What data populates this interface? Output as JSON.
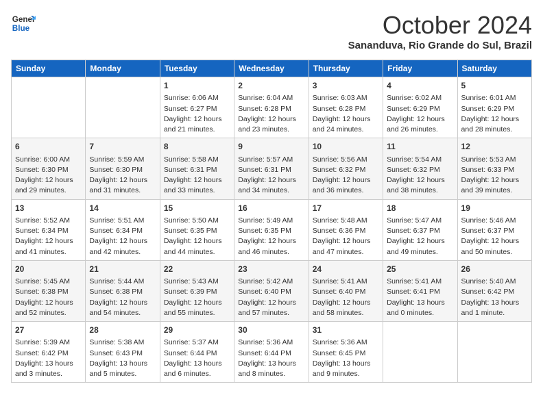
{
  "header": {
    "logo_line1": "General",
    "logo_line2": "Blue",
    "month": "October 2024",
    "location": "Sananduva, Rio Grande do Sul, Brazil"
  },
  "days_of_week": [
    "Sunday",
    "Monday",
    "Tuesday",
    "Wednesday",
    "Thursday",
    "Friday",
    "Saturday"
  ],
  "weeks": [
    [
      {
        "day": "",
        "info": ""
      },
      {
        "day": "",
        "info": ""
      },
      {
        "day": "1",
        "info": "Sunrise: 6:06 AM\nSunset: 6:27 PM\nDaylight: 12 hours and 21 minutes."
      },
      {
        "day": "2",
        "info": "Sunrise: 6:04 AM\nSunset: 6:28 PM\nDaylight: 12 hours and 23 minutes."
      },
      {
        "day": "3",
        "info": "Sunrise: 6:03 AM\nSunset: 6:28 PM\nDaylight: 12 hours and 24 minutes."
      },
      {
        "day": "4",
        "info": "Sunrise: 6:02 AM\nSunset: 6:29 PM\nDaylight: 12 hours and 26 minutes."
      },
      {
        "day": "5",
        "info": "Sunrise: 6:01 AM\nSunset: 6:29 PM\nDaylight: 12 hours and 28 minutes."
      }
    ],
    [
      {
        "day": "6",
        "info": "Sunrise: 6:00 AM\nSunset: 6:30 PM\nDaylight: 12 hours and 29 minutes."
      },
      {
        "day": "7",
        "info": "Sunrise: 5:59 AM\nSunset: 6:30 PM\nDaylight: 12 hours and 31 minutes."
      },
      {
        "day": "8",
        "info": "Sunrise: 5:58 AM\nSunset: 6:31 PM\nDaylight: 12 hours and 33 minutes."
      },
      {
        "day": "9",
        "info": "Sunrise: 5:57 AM\nSunset: 6:31 PM\nDaylight: 12 hours and 34 minutes."
      },
      {
        "day": "10",
        "info": "Sunrise: 5:56 AM\nSunset: 6:32 PM\nDaylight: 12 hours and 36 minutes."
      },
      {
        "day": "11",
        "info": "Sunrise: 5:54 AM\nSunset: 6:32 PM\nDaylight: 12 hours and 38 minutes."
      },
      {
        "day": "12",
        "info": "Sunrise: 5:53 AM\nSunset: 6:33 PM\nDaylight: 12 hours and 39 minutes."
      }
    ],
    [
      {
        "day": "13",
        "info": "Sunrise: 5:52 AM\nSunset: 6:34 PM\nDaylight: 12 hours and 41 minutes."
      },
      {
        "day": "14",
        "info": "Sunrise: 5:51 AM\nSunset: 6:34 PM\nDaylight: 12 hours and 42 minutes."
      },
      {
        "day": "15",
        "info": "Sunrise: 5:50 AM\nSunset: 6:35 PM\nDaylight: 12 hours and 44 minutes."
      },
      {
        "day": "16",
        "info": "Sunrise: 5:49 AM\nSunset: 6:35 PM\nDaylight: 12 hours and 46 minutes."
      },
      {
        "day": "17",
        "info": "Sunrise: 5:48 AM\nSunset: 6:36 PM\nDaylight: 12 hours and 47 minutes."
      },
      {
        "day": "18",
        "info": "Sunrise: 5:47 AM\nSunset: 6:37 PM\nDaylight: 12 hours and 49 minutes."
      },
      {
        "day": "19",
        "info": "Sunrise: 5:46 AM\nSunset: 6:37 PM\nDaylight: 12 hours and 50 minutes."
      }
    ],
    [
      {
        "day": "20",
        "info": "Sunrise: 5:45 AM\nSunset: 6:38 PM\nDaylight: 12 hours and 52 minutes."
      },
      {
        "day": "21",
        "info": "Sunrise: 5:44 AM\nSunset: 6:38 PM\nDaylight: 12 hours and 54 minutes."
      },
      {
        "day": "22",
        "info": "Sunrise: 5:43 AM\nSunset: 6:39 PM\nDaylight: 12 hours and 55 minutes."
      },
      {
        "day": "23",
        "info": "Sunrise: 5:42 AM\nSunset: 6:40 PM\nDaylight: 12 hours and 57 minutes."
      },
      {
        "day": "24",
        "info": "Sunrise: 5:41 AM\nSunset: 6:40 PM\nDaylight: 12 hours and 58 minutes."
      },
      {
        "day": "25",
        "info": "Sunrise: 5:41 AM\nSunset: 6:41 PM\nDaylight: 13 hours and 0 minutes."
      },
      {
        "day": "26",
        "info": "Sunrise: 5:40 AM\nSunset: 6:42 PM\nDaylight: 13 hours and 1 minute."
      }
    ],
    [
      {
        "day": "27",
        "info": "Sunrise: 5:39 AM\nSunset: 6:42 PM\nDaylight: 13 hours and 3 minutes."
      },
      {
        "day": "28",
        "info": "Sunrise: 5:38 AM\nSunset: 6:43 PM\nDaylight: 13 hours and 5 minutes."
      },
      {
        "day": "29",
        "info": "Sunrise: 5:37 AM\nSunset: 6:44 PM\nDaylight: 13 hours and 6 minutes."
      },
      {
        "day": "30",
        "info": "Sunrise: 5:36 AM\nSunset: 6:44 PM\nDaylight: 13 hours and 8 minutes."
      },
      {
        "day": "31",
        "info": "Sunrise: 5:36 AM\nSunset: 6:45 PM\nDaylight: 13 hours and 9 minutes."
      },
      {
        "day": "",
        "info": ""
      },
      {
        "day": "",
        "info": ""
      }
    ]
  ]
}
